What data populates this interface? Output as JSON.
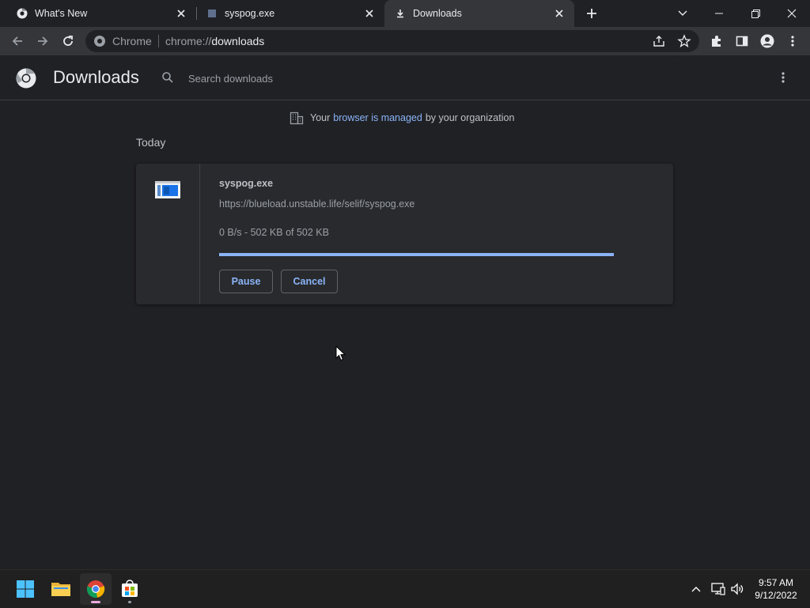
{
  "tabs": [
    {
      "title": "What's New",
      "active": false
    },
    {
      "title": "syspog.exe",
      "active": false
    },
    {
      "title": "Downloads",
      "active": true
    }
  ],
  "omnibox": {
    "site_label": "Chrome",
    "scheme": "chrome://",
    "host": "downloads"
  },
  "header": {
    "title": "Downloads",
    "search_placeholder": "Search downloads"
  },
  "managed": {
    "prefix": "Your",
    "link": "browser is managed",
    "suffix": "by your organization"
  },
  "section_date": "Today",
  "download": {
    "filename": "syspog.exe",
    "url": "https://blueload.unstable.life/selif/syspog.exe",
    "status": "0 B/s - 502 KB of 502 KB",
    "progress": 1.0,
    "pause_label": "Pause",
    "cancel_label": "Cancel"
  },
  "taskbar": {
    "apps": [
      "start-icon",
      "file-explorer-icon",
      "chrome-icon",
      "microsoft-store-icon"
    ],
    "time": "9:57 AM",
    "date": "9/12/2022"
  },
  "colors": {
    "accent": "#8ab4f8",
    "background": "#202124",
    "card": "#292a2d"
  }
}
